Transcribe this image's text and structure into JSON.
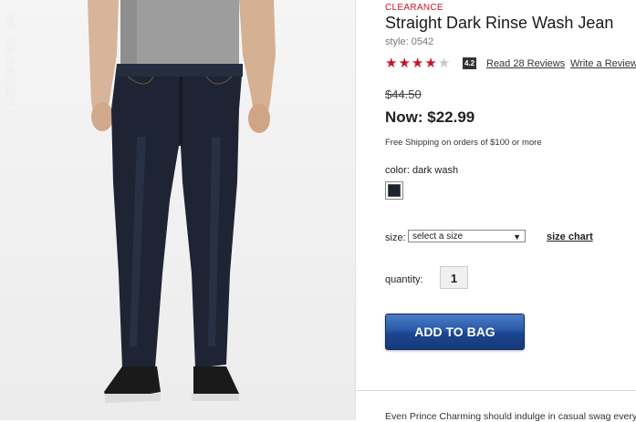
{
  "photo": {
    "watermark": "Ladies.ep.ua"
  },
  "product": {
    "clearance_label": "CLEARANCE",
    "title": "Straight Dark Rinse Wash Jean",
    "style": "style: 0542",
    "rating": {
      "stars_filled": 4,
      "stars_total": 5,
      "score": "4.2",
      "read_reviews": "Read 28 Reviews",
      "write_review": "Write a Review"
    },
    "old_price": "$44.50",
    "now_price": "Now: $22.99",
    "shipping_note": "Free Shipping on orders of $100 or more",
    "color_label": "color: dark wash",
    "swatch_color": "#1d2230",
    "size_label": "size:",
    "size_select": "select a size",
    "size_chart": "size chart",
    "quantity_label": "quantity:",
    "quantity_value": "1",
    "add_to_bag": "ADD TO BAG",
    "description_teaser": "Even Prince Charming should indulge in casual swag every"
  },
  "colors": {
    "accent_red": "#c4162a",
    "button_blue": "#2a5aa8"
  }
}
